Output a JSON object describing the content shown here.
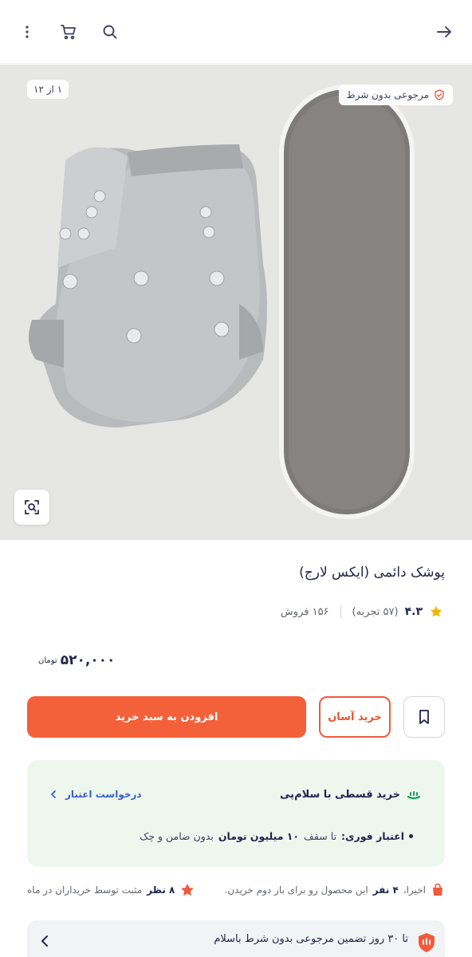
{
  "topbar": {
    "icons": [
      "more-vertical-icon",
      "cart-icon",
      "search-icon",
      "arrow-right-icon"
    ]
  },
  "gallery": {
    "counter": "۱ از ۱۲",
    "return_badge": "مرجوعی بدون شرط"
  },
  "product": {
    "title": "پوشک دائمی (ایکس لارج)",
    "rating": "۴.۳",
    "reviews": "(۵۷ تجربه)",
    "sales": "۱۵۶ فروش"
  },
  "price": {
    "amount": "۵۲۰,۰۰۰",
    "currency": "تومان"
  },
  "actions": {
    "easy_buy": "خرید آسان",
    "add_to_cart": "افزودن به سبد خرید"
  },
  "credit": {
    "title": "خرید قسطی با سلام‌پی",
    "link": "درخواست اعتبار",
    "bullet_label": "اعتبار فوری:",
    "bullet_text1": "تا سقف",
    "bullet_amount": "۱۰ میلیون تومان",
    "bullet_text2": "بدون ضامن و چک"
  },
  "social": {
    "recent_prefix": "اخیرا،",
    "recent_count": "۴ نفر",
    "recent_suffix": "این محصول رو برای بار دوم خریدن.",
    "opinion_count": "۸ نظر",
    "opinion_suffix": "مثبت توسط خریداران در ماه"
  },
  "guarantee": {
    "text": "تا ۳۰ روز تضمین مرجوعی بدون شرط باسلام"
  },
  "colors": {
    "accent": "#f4603a",
    "credit_bg": "#eef7ee",
    "link": "#3c5fd0",
    "star": "#f5b400"
  }
}
